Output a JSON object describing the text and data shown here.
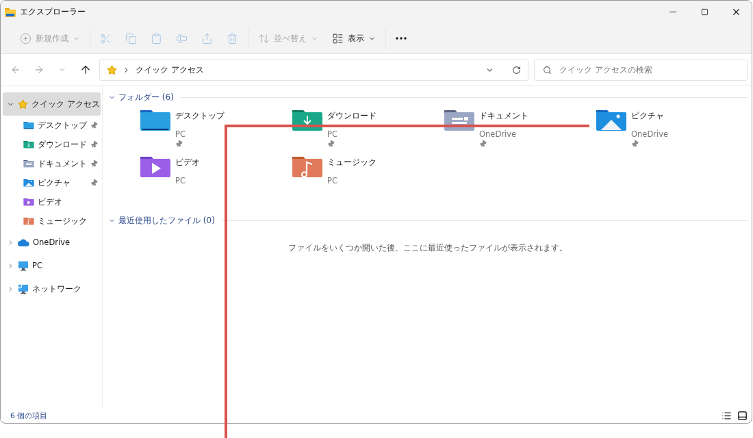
{
  "window": {
    "title": "エクスプローラー"
  },
  "toolbar": [
    [
      {
        "kind": "new",
        "label": "新規作成",
        "disabled": true
      }
    ],
    [
      {
        "kind": "cut",
        "disabled": true
      },
      {
        "kind": "copy",
        "disabled": true
      },
      {
        "kind": "paste",
        "disabled": true
      },
      {
        "kind": "rename",
        "disabled": true
      },
      {
        "kind": "share",
        "disabled": true
      },
      {
        "kind": "delete",
        "disabled": true
      }
    ],
    [
      {
        "kind": "sort",
        "label": "並べ替え",
        "disabled": true
      },
      {
        "kind": "view",
        "label": "表示",
        "disabled": false
      }
    ],
    [
      {
        "kind": "more",
        "disabled": false
      }
    ]
  ],
  "navigation": [
    {
      "kind": "back",
      "disabled": true
    },
    {
      "kind": "forward",
      "disabled": true
    },
    {
      "kind": "recent",
      "disabled": true
    },
    {
      "kind": "up",
      "disabled": false
    }
  ],
  "address": {
    "path": "クイック アクセス"
  },
  "search": {
    "placeholder": "クイック アクセスの検索"
  },
  "sidebar": {
    "items": [
      {
        "label": "クイック アクセス",
        "kind": "star",
        "selected": true,
        "expanded": true,
        "children": [
          {
            "label": "デスクトップ",
            "kind": "desktop",
            "pinned": true,
            "selected": false
          },
          {
            "label": "ダウンロード",
            "kind": "download",
            "pinned": true,
            "selected": false
          },
          {
            "label": "ドキュメント",
            "kind": "documents",
            "pinned": true,
            "selected": false
          },
          {
            "label": "ピクチャ",
            "kind": "pictures",
            "pinned": true,
            "selected": false
          },
          {
            "label": "ビデオ",
            "kind": "videos",
            "pinned": false,
            "selected": false
          },
          {
            "label": "ミュージック",
            "kind": "music",
            "pinned": false,
            "selected": false
          }
        ]
      },
      {
        "label": "OneDrive",
        "kind": "cloud",
        "selected": false,
        "expanded": false
      },
      {
        "label": "PC",
        "kind": "pc",
        "selected": false,
        "expanded": false
      },
      {
        "label": "ネットワーク",
        "kind": "network",
        "selected": false,
        "expanded": false
      }
    ]
  },
  "sections": [
    {
      "title": "フォルダー (6)",
      "expanded": true,
      "folders": [
        {
          "name": "デスクトップ",
          "location": "PC",
          "kind": "desktop",
          "pinned": true
        },
        {
          "name": "ダウンロード",
          "location": "PC",
          "kind": "download",
          "pinned": true
        },
        {
          "name": "ドキュメント",
          "location": "OneDrive",
          "kind": "documents",
          "pinned": true
        },
        {
          "name": "ピクチャ",
          "location": "OneDrive",
          "kind": "pictures",
          "pinned": true
        },
        {
          "name": "ビデオ",
          "location": "PC",
          "kind": "videos",
          "pinned": false
        },
        {
          "name": "ミュージック",
          "location": "PC",
          "kind": "music",
          "pinned": false
        }
      ]
    },
    {
      "title": "最近使用したファイル (0)",
      "expanded": true,
      "empty_message": "ファイルをいくつか開いた後、ここに最近使ったファイルが表示されます。"
    }
  ],
  "status_bar": {
    "count": "6 個の項目"
  }
}
